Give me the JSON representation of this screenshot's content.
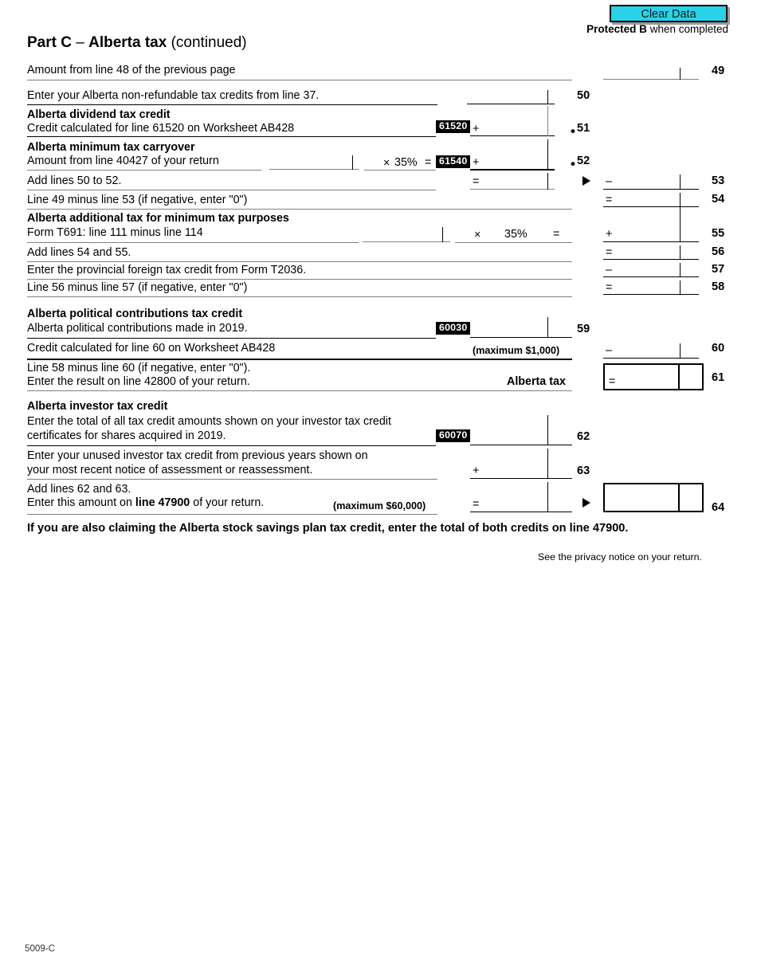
{
  "header": {
    "clear_data_label": "Clear Data",
    "protected_bold": "Protected B",
    "protected_rest": " when completed",
    "part_title_bold": "Part C",
    "part_title_dash": " – ",
    "part_title_bold2": "Alberta tax",
    "part_title_normal": " (continued)"
  },
  "rows": {
    "l49": {
      "label": "Amount from line 48 of the previous page",
      "number": "49"
    },
    "l50": {
      "label": "Enter your Alberta non-refundable tax credits from line 37.",
      "number": "50"
    },
    "dividend_heading": "Alberta dividend tax credit",
    "l51": {
      "label": "Credit calculated for line 61520 on Worksheet AB428",
      "code": "61520",
      "op": "+",
      "number": "51",
      "dot": "•"
    },
    "carryover_heading": "Alberta minimum tax carryover",
    "l52": {
      "label": "Amount from line 40427 of your return",
      "multiply": "×",
      "rate": "35%",
      "equals": "=",
      "code": "61540",
      "op": "+",
      "number": "52",
      "dot": "•"
    },
    "l53": {
      "label": "Add lines 50 to 52.",
      "mid_op": "=",
      "op": "–",
      "number": "53"
    },
    "l54": {
      "label": "Line 49 minus line 53 (if negative, enter \"0\")",
      "op": "=",
      "number": "54"
    },
    "addtl_heading": "Alberta additional tax for minimum tax purposes",
    "l55": {
      "label": "Form T691: line 111 minus line 114",
      "multiply": "×",
      "rate": "35%",
      "equals": "=",
      "op": "+",
      "number": "55"
    },
    "l56": {
      "label": "Add lines 54 and 55.",
      "op": "=",
      "number": "56"
    },
    "l57": {
      "label": "Enter the provincial foreign tax credit from Form T2036.",
      "op": "–",
      "number": "57"
    },
    "l58": {
      "label": "Line 56 minus line 57 (if negative, enter \"0\")",
      "op": "=",
      "number": "58"
    },
    "political_heading": "Alberta political contributions tax credit",
    "l59": {
      "label": "Alberta political contributions made in 2019.",
      "code": "60030",
      "number": "59"
    },
    "l60": {
      "label": "Credit calculated for line 60 on Worksheet AB428",
      "maximum": "(maximum $1,000)",
      "op": "–",
      "number": "60"
    },
    "l61": {
      "label_1": "Line 58 minus line 60 (if negative, enter \"0\").",
      "label_2": "Enter the result on line 42800 of your return.",
      "caption": "Alberta tax",
      "op": "=",
      "number": "61"
    },
    "investor_heading": "Alberta investor tax credit",
    "l62": {
      "label_1": "Enter the total of all tax credit amounts shown on your investor tax credit",
      "label_2": "certificates for shares acquired in 2019.",
      "code": "60070",
      "number": "62"
    },
    "l63": {
      "label_1": "Enter your unused investor tax credit from previous years shown on",
      "label_2": "your most recent notice of assessment or reassessment.",
      "op": "+",
      "number": "63"
    },
    "l64": {
      "label_1": "Add lines 62 and 63.",
      "label_2a": "Enter this amount on ",
      "label_2b": "line 47900",
      "label_2c": " of your return.",
      "maximum": "(maximum $60,000)",
      "op": "=",
      "number": "64"
    }
  },
  "footer": {
    "note": "If you are also claiming the Alberta stock savings plan tax credit, enter the total of both credits on line 47900.",
    "privacy": "See the privacy notice on your return.",
    "form_code": "5009-C"
  },
  "colors": {
    "clear_data_bg": "#2ad2e8",
    "rule_gray": "#808080",
    "rule_black": "#000000"
  }
}
